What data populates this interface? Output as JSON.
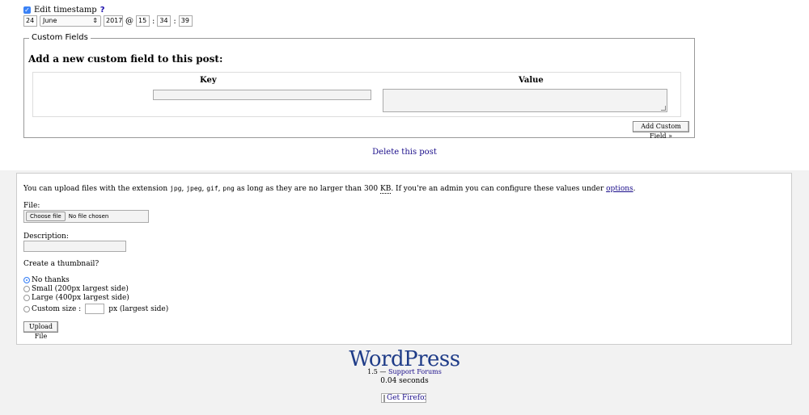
{
  "timestamp": {
    "checkbox_label": "Edit timestamp",
    "help": "?",
    "day": "24",
    "month": "June",
    "year": "2017",
    "at": "@",
    "hour": "15",
    "minute": "34",
    "second": "39",
    "colon": ":"
  },
  "custom_fields": {
    "legend": "Custom Fields",
    "heading": "Add a new custom field to this post:",
    "key_header": "Key",
    "value_header": "Value",
    "add_button": "Add Custom Field »"
  },
  "delete_link": "Delete this post",
  "upload": {
    "text_before": "You can upload files with the extension ",
    "ext1": "jpg",
    "ext2": "jpeg",
    "ext3": "gif",
    "ext4": "png",
    "text_middle": " as long as they are no larger than 300 ",
    "kb": "KB",
    "text_after": ". If you're an admin you can configure these values under ",
    "options_link": "options",
    "period": ".",
    "file_label": "File:",
    "choose_button": "Choose file",
    "no_file": "No file chosen",
    "description_label": "Description:",
    "thumbnail_label": "Create a thumbnail?",
    "radio_options": [
      "No thanks",
      "Small (200px largest side)",
      "Large (400px largest side)",
      "Custom size :"
    ],
    "custom_suffix": "px (largest side)",
    "upload_button": "Upload File"
  },
  "footer": {
    "logo": "WordPress",
    "version": "1.5",
    "dash": " — ",
    "support_link": "Support Forums",
    "time": "0.04 seconds",
    "firefox_alt": "Get Firefox"
  }
}
